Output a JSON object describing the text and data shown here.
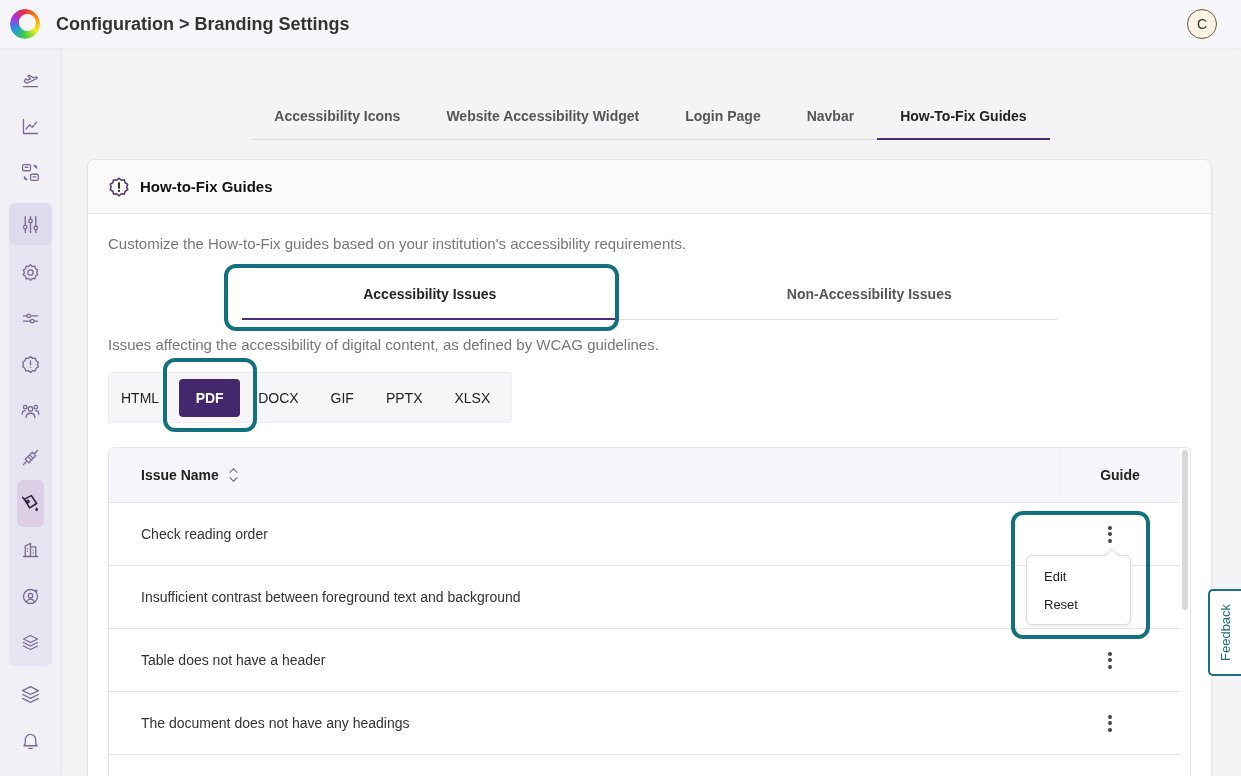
{
  "header": {
    "title": "Configuration > Branding Settings",
    "avatar": "C"
  },
  "sidebar": {
    "sections": [
      {
        "kind": "plain",
        "items": [
          {
            "selected": false
          },
          {
            "selected": false
          },
          {
            "selected": false
          }
        ]
      },
      {
        "kind": "group",
        "items": [
          {
            "selected": false
          },
          {
            "selected": false
          },
          {
            "selected": false
          },
          {
            "selected": false
          },
          {
            "selected": false
          },
          {
            "selected": false
          },
          {
            "selected": true
          },
          {
            "selected": false
          },
          {
            "selected": false
          },
          {
            "selected": false
          }
        ]
      },
      {
        "kind": "plain",
        "items": [
          {
            "selected": false
          },
          {
            "selected": false
          }
        ]
      }
    ]
  },
  "tabs": [
    {
      "label": "Accessibility Icons",
      "selected": false
    },
    {
      "label": "Website Accessibility Widget",
      "selected": false
    },
    {
      "label": "Login Page",
      "selected": false
    },
    {
      "label": "Navbar",
      "selected": false
    },
    {
      "label": "How-To-Fix Guides",
      "selected": true
    }
  ],
  "card": {
    "title": "How-to-Fix Guides",
    "description": "Customize the How-to-Fix guides based on your institution's accessibility requirements.",
    "issue_tabs": [
      {
        "label": "Accessibility Issues",
        "selected": true
      },
      {
        "label": "Non-Accessibility Issues",
        "selected": false
      }
    ],
    "issue_description": "Issues affecting the accessibility of digital content, as defined by WCAG guidelines.",
    "file_types": [
      {
        "label": "HTML",
        "selected": false
      },
      {
        "label": "PDF",
        "selected": true
      },
      {
        "label": "DOCX",
        "selected": false
      },
      {
        "label": "GIF",
        "selected": false
      },
      {
        "label": "PPTX",
        "selected": false
      },
      {
        "label": "XLSX",
        "selected": false
      }
    ],
    "table": {
      "columns": [
        {
          "label": "Issue Name",
          "sortable": true
        },
        {
          "label": "Guide",
          "sortable": false
        }
      ],
      "rows": [
        {
          "issue": "Check reading order",
          "menu_open": true
        },
        {
          "issue": "Insufficient contrast between foreground text and background",
          "menu_open": false
        },
        {
          "issue": "Table does not have a header",
          "menu_open": false
        },
        {
          "issue": "The document does not have any headings",
          "menu_open": false
        }
      ],
      "menu": [
        "Edit",
        "Reset"
      ]
    }
  },
  "feedback": "Feedback"
}
